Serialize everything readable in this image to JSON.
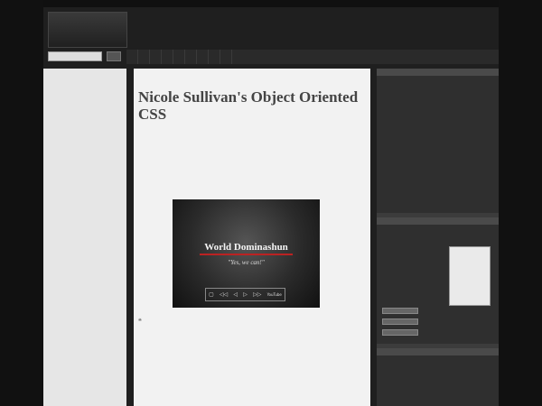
{
  "header": {
    "top_link": "",
    "logo_text": "",
    "tagline": "",
    "search_placeholder": "",
    "search_button": "",
    "nav": [
      "",
      "",
      "",
      "",
      "",
      "",
      "",
      "",
      ""
    ]
  },
  "sidebar_left": {
    "heading_1": "",
    "featured": "",
    "heading_2": "",
    "categories": [
      "",
      "",
      "",
      "",
      "",
      "",
      "",
      "",
      "",
      "",
      "",
      "",
      "",
      "",
      "",
      "",
      "",
      "",
      "",
      "",
      "",
      "",
      "",
      "",
      "",
      "",
      "",
      "",
      "",
      "",
      "",
      "",
      "",
      "",
      "",
      "",
      ""
    ]
  },
  "post": {
    "meta_line_1": "",
    "meta_line_2": "",
    "title": "Nicole Sullivan's Object Oriented CSS",
    "byline": "",
    "paragraph_1": "",
    "video_title": "World Dominashun",
    "video_subtitle": "\"Yes, we can!\"",
    "video_controls": [
      "▢",
      "◁◁",
      "◁",
      "▷",
      "▷▷",
      "YouTube"
    ],
    "paragraph_2": "",
    "paragraph_3": "",
    "link_text": ""
  },
  "sidebar_right": {
    "box_1_heading": "",
    "box_1_items": [
      "",
      "",
      "",
      "",
      "",
      "",
      "",
      "",
      "",
      "",
      "",
      ""
    ],
    "box_2_heading": "",
    "rss_label": "",
    "rss_text": "",
    "box_3_heading": "",
    "box_3_items": [
      "",
      "",
      "",
      "",
      ""
    ]
  },
  "colors": {
    "background": "#111111",
    "main_bg": "#f2f2f2",
    "sidebar_left_bg": "#e6e6e6",
    "sidebar_right_bg": "#3c3c3c",
    "accent": "#bb2222"
  }
}
